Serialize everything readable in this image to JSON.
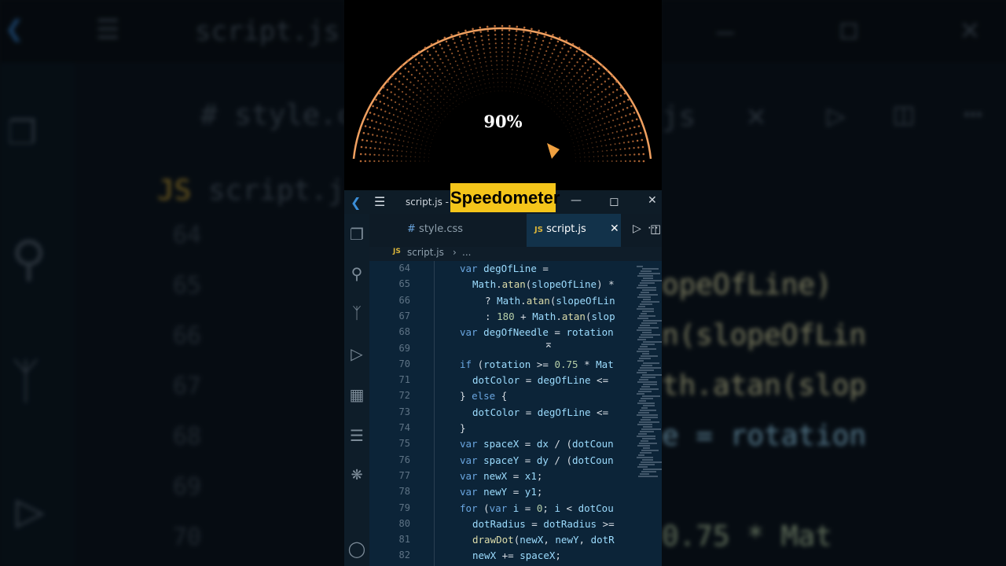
{
  "gauge": {
    "percent_label": "90%",
    "value": 0.9
  },
  "banner": {
    "text": "Speedometer"
  },
  "window": {
    "title": "script.js -"
  },
  "tabs": [
    {
      "label": "style.css",
      "icon": "#"
    },
    {
      "label": "script.js",
      "icon": "JS"
    }
  ],
  "breadcrumb": {
    "file": "script.js",
    "rest": "..."
  },
  "code_lines": [
    {
      "n": "64",
      "text": "var degOfLine =",
      "indent": 0
    },
    {
      "n": "65",
      "text": "Math.atan(slopeOfLine) *",
      "indent": 1
    },
    {
      "n": "66",
      "text": "? Math.atan(slopeOfLin",
      "indent": 2
    },
    {
      "n": "67",
      "text": ": 180 + Math.atan(slop",
      "indent": 2
    },
    {
      "n": "68",
      "text": "var degOfNeedle = rotation",
      "indent": 0
    },
    {
      "n": "69",
      "text": "",
      "indent": 0
    },
    {
      "n": "70",
      "text": "if (rotation >= 0.75 * Mat",
      "indent": 0
    },
    {
      "n": "71",
      "text": "dotColor = degOfLine <=",
      "indent": 1
    },
    {
      "n": "72",
      "text": "} else {",
      "indent": 0
    },
    {
      "n": "73",
      "text": "dotColor = degOfLine <=",
      "indent": 1
    },
    {
      "n": "74",
      "text": "}",
      "indent": 0
    },
    {
      "n": "75",
      "text": "var spaceX = dx / (dotCoun",
      "indent": 0
    },
    {
      "n": "76",
      "text": "var spaceY = dy / (dotCoun",
      "indent": 0
    },
    {
      "n": "77",
      "text": "var newX = x1;",
      "indent": 0
    },
    {
      "n": "78",
      "text": "var newY = y1;",
      "indent": 0
    },
    {
      "n": "79",
      "text": "for (var i = 0; i < dotCou",
      "indent": 0
    },
    {
      "n": "80",
      "text": "dotRadius = dotRadius >=",
      "indent": 1
    },
    {
      "n": "81",
      "text": "drawDot(newX, newY, dotR",
      "indent": 1
    },
    {
      "n": "82",
      "text": "newX += spaceX;",
      "indent": 1
    }
  ],
  "background": {
    "title_left": "script.js -",
    "tab_left": "style.cs",
    "tab_js": "script.js",
    "line_numbers": [
      "64",
      "65",
      "66",
      "67",
      "68",
      "69",
      "70"
    ],
    "right_code": [
      "opeOfLine)",
      "n(slopeOfLin",
      "th.atan(slop",
      "e = rotation",
      "",
      "0.75 * Mat"
    ],
    "right_tab_fragment": "js"
  },
  "colors": {
    "gauge_arc": "#f0a060",
    "gauge_needle": "#f0a040",
    "banner_bg": "#f4c51a",
    "editor_bg": "#0c2438",
    "accent": "#3b8ed8"
  },
  "icons": {
    "vscode": "vscode-logo-icon",
    "menu": "hamburger-menu-icon",
    "explorer": "files-icon",
    "search": "search-icon",
    "scm": "source-control-icon",
    "debug": "run-debug-icon",
    "extensions": "extensions-icon",
    "outline": "list-icon",
    "copilot": "copilot-icon",
    "account": "account-icon"
  }
}
